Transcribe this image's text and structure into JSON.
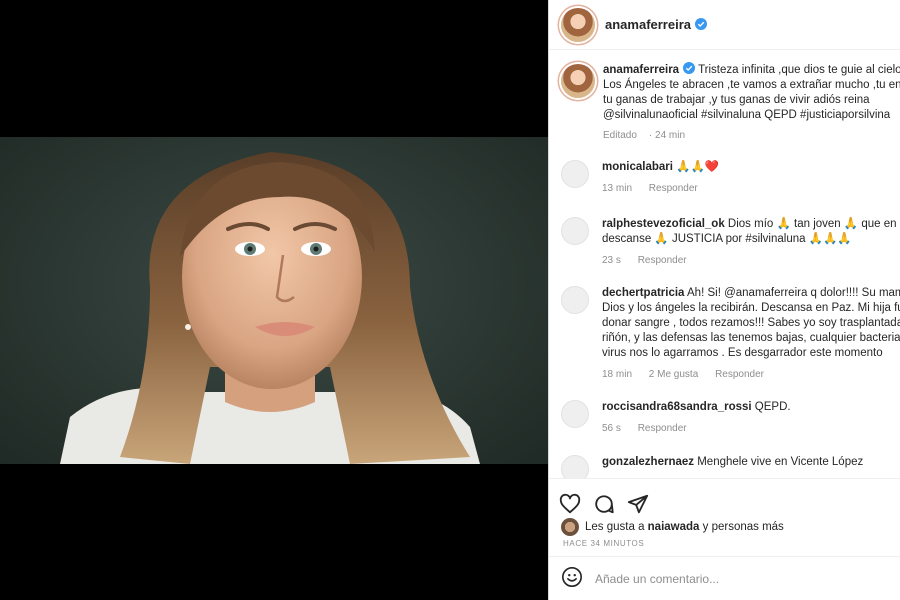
{
  "post": {
    "author": "anamaferreira",
    "caption": {
      "username": "anamaferreira",
      "text_line1": " Tristeza infinita ,que dios te guie al cielo",
      "text_line2": "Los Ángeles te abracen ,te vamos a extrañar mucho ,tu en",
      "text_line3": "tu ganas de trabajar ,y tus ganas de vivir adiós reina",
      "text_line4": "@silvinalunaoficial #silvinaluna QEPD #justiciaporsilvina",
      "edited": "Editado",
      "time": "24 min"
    },
    "comments": [
      {
        "username": "monicalabari",
        "text": " 🙏🙏❤️",
        "time": "13 min",
        "likes": "",
        "reply": "Responder"
      },
      {
        "username": "ralphestevezoficial_ok",
        "text": " Dios mío 🙏 tan joven 🙏 que en p",
        "text2": "descanse 🙏 JUSTICIA por #silvinaluna 🙏🙏🙏",
        "time": "23 s",
        "likes": "",
        "reply": "Responder"
      },
      {
        "username": "dechertpatricia",
        "text": " Ah! Si! @anamaferreira q dolor!!!! Su mam",
        "text2": "Dios y los ángeles la recibirán. Descansa en Paz. Mi hija fue",
        "text3": "donar sangre , todos rezamos!!! Sabes yo soy trasplantada",
        "text4": "riñón, y las defensas las tenemos bajas, cualquier bacteria",
        "text5": "virus nos lo agarramos . Es desgarrador este momento",
        "time": "18 min",
        "likes": "2 Me gusta",
        "reply": "Responder"
      },
      {
        "username": "roccisandra68sandra_rossi",
        "text": " QEPD.",
        "time": "56 s",
        "likes": "",
        "reply": "Responder"
      },
      {
        "username": "gonzalezhernaez",
        "text": " Menghele vive en Vicente López"
      }
    ],
    "likes_text_pre": "Les gusta a ",
    "likes_user": "naiawada",
    "likes_text_post": " y personas más",
    "time_ago": "HACE 34 MINUTOS",
    "add_comment_placeholder": "Añade un comentario..."
  },
  "icons": {
    "like": "heart-icon",
    "comment": "comment-icon",
    "share": "share-icon",
    "emoji": "emoji-icon",
    "verified": "verified-badge-icon"
  },
  "colors": {
    "verified": "#3897f0",
    "text": "#262626",
    "secondary": "#8e8e8e"
  }
}
